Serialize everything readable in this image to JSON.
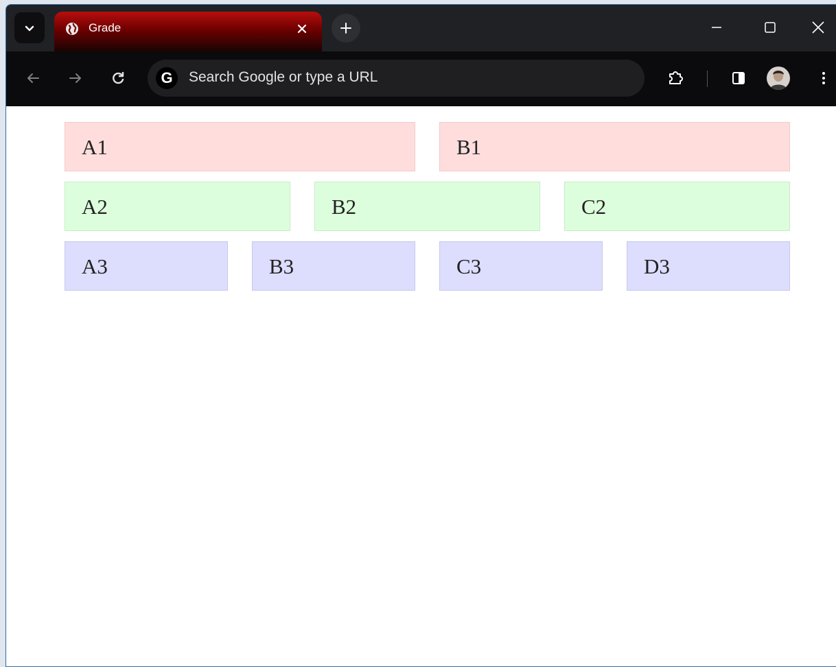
{
  "browser": {
    "tab_title": "Grade",
    "omnibox_placeholder": "Search Google or type a URL",
    "google_letter": "G"
  },
  "grid": {
    "row1": [
      "A1",
      "B1"
    ],
    "row2": [
      "A2",
      "B2",
      "C2"
    ],
    "row3": [
      "A3",
      "B3",
      "C3",
      "D3"
    ]
  },
  "colors": {
    "row1_bg": "#ffdddd",
    "row2_bg": "#ddfedd",
    "row3_bg": "#ddddfe",
    "tab_accent": "#b80e0e"
  },
  "icons": [
    "chevron-down-icon",
    "globe-icon",
    "close-icon",
    "plus-icon",
    "minimize-icon",
    "maximize-icon",
    "back-arrow-icon",
    "forward-arrow-icon",
    "reload-icon",
    "google-icon",
    "extensions-icon",
    "side-panel-icon",
    "avatar",
    "kebab-menu-icon"
  ]
}
